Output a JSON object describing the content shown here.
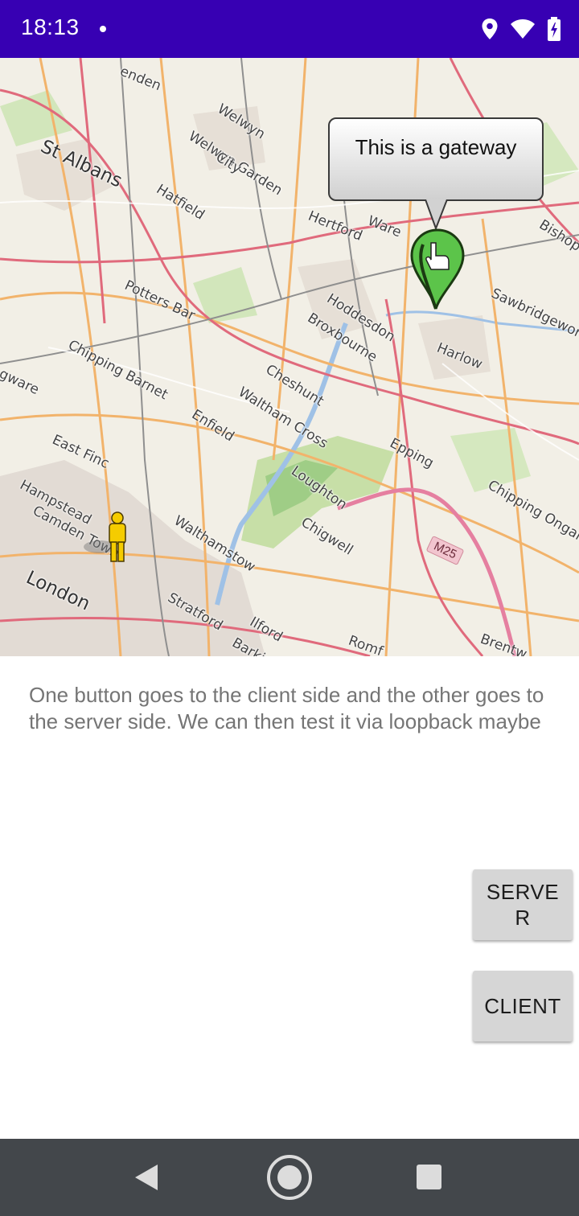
{
  "status_bar": {
    "time": "18:13",
    "icons": [
      "location-icon",
      "wifi-icon",
      "battery-icon"
    ],
    "background": "#3700b3"
  },
  "map": {
    "labels": {
      "st_albans": "St Albans",
      "welwyn": "Welwyn",
      "welwyn_garden_city": "Welwyn Garden",
      "city": "City",
      "hatfield": "Hatfield",
      "hertford": "Hertford",
      "ware": "Ware",
      "potters_bar": "Potters Bar",
      "hoddesdon": "Hoddesdon",
      "broxbourne": "Broxbourne",
      "sawbridgeworth": "Sawbridgeworth",
      "harlow": "Harlow",
      "chipping_barnet": "Chipping Barnet",
      "cheshunt": "Cheshunt",
      "waltham_cross": "Waltham Cross",
      "enfield": "Enfield",
      "epping": "Epping",
      "chipping_ongar": "Chipping Ongar",
      "east_finchley": "East Finc",
      "hampstead": "Hampstead",
      "camden_town": "Camden Town",
      "loughton": "Loughton",
      "chigwell": "Chigwell",
      "walthamstow": "Walthamstow",
      "london": "London",
      "stratford": "Stratford",
      "ilford": "Ilford",
      "romford": "Romf",
      "barking": "Barkin",
      "brentwood": "Brentw",
      "bishop": "Bishop",
      "harpenden": "enden",
      "edgware": "gware",
      "m25": "M25"
    },
    "gateway_bubble": "This is a gateway"
  },
  "description": "One button goes to the client side and the other goes to the server side. We can then test it via loopback maybe",
  "buttons": {
    "server": "SERVER",
    "client": "CLIENT"
  },
  "nav_bar": {
    "icons": [
      "back-icon",
      "home-icon",
      "recents-icon"
    ]
  }
}
